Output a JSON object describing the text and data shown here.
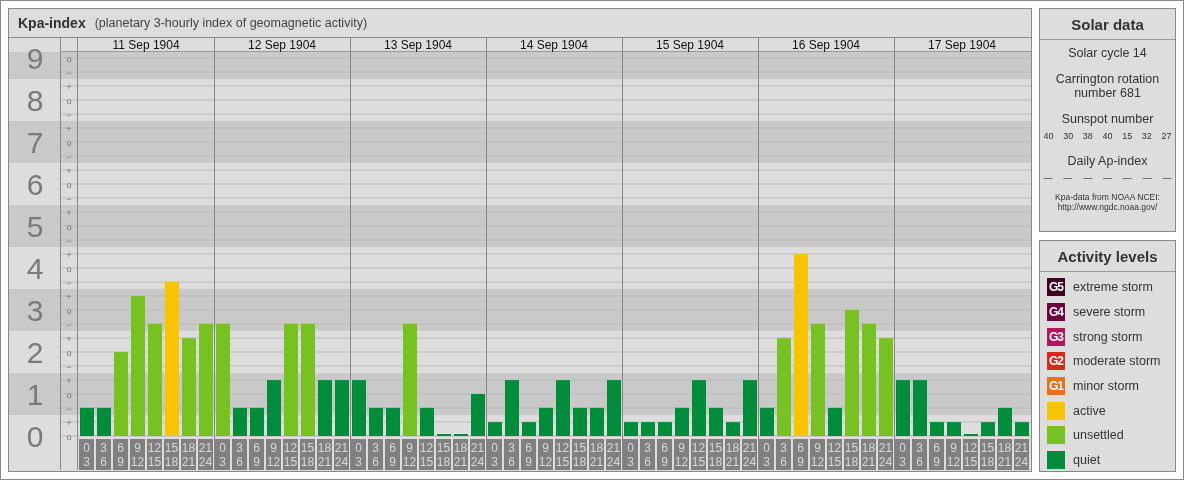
{
  "kpa_panel": {
    "title": "Kpa-index",
    "subtitle": "(planetary 3-hourly index of geomagnetic activity)",
    "days": [
      "11 Sep 1904",
      "12 Sep 1904",
      "13 Sep 1904",
      "14 Sep 1904",
      "15 Sep 1904",
      "16 Sep 1904",
      "17 Sep 1904"
    ],
    "minor_ticks": [
      "o",
      "−",
      "+",
      "o",
      "−",
      "+",
      "o",
      "−",
      "+",
      "o",
      "−",
      "+",
      "o",
      "−",
      "+",
      "o",
      "−",
      "+",
      "o",
      "−",
      "+",
      "o",
      "−",
      "+",
      "o",
      "−",
      "+",
      "o"
    ],
    "chart_data": {
      "type": "bar",
      "stacked": true,
      "categories": [
        "0\n3",
        "3\n6",
        "6\n9",
        "9\n12",
        "12\n15",
        "15\n18",
        "18\n21",
        "21\n24",
        "0\n3",
        "3\n6",
        "6\n9",
        "9\n12",
        "12\n15",
        "15\n18",
        "18\n21",
        "21\n24",
        "0\n3",
        "3\n6",
        "6\n9",
        "9\n12",
        "12\n15",
        "15\n18",
        "18\n21",
        "21\n24",
        "0\n3",
        "3\n6",
        "6\n9",
        "9\n12",
        "12\n15",
        "15\n18",
        "18\n21",
        "21\n24",
        "0\n3",
        "3\n6",
        "6\n9",
        "9\n12",
        "12\n15",
        "15\n18",
        "18\n21",
        "21\n24",
        "0\n3",
        "3\n6",
        "6\n9",
        "9\n12",
        "12\n15",
        "15\n18",
        "18\n21",
        "21\n24",
        "0\n3",
        "3\n6",
        "6\n9",
        "9\n12",
        "12\n15",
        "15\n18",
        "18\n21",
        "21\n24"
      ],
      "yticks": [
        {
          "value": 0,
          "label": "0"
        },
        {
          "value": 1,
          "label": "1"
        },
        {
          "value": 2,
          "label": "2"
        },
        {
          "value": 3,
          "label": "3"
        },
        {
          "value": 4,
          "label": "4"
        },
        {
          "value": 5,
          "label": "5"
        },
        {
          "value": 6,
          "label": "6"
        },
        {
          "value": 7,
          "label": "7"
        },
        {
          "value": 8,
          "label": "8"
        },
        {
          "value": 9,
          "label": "9"
        }
      ],
      "ylim": [
        0,
        9.14
      ],
      "grid": true,
      "series": [
        {
          "name": "active",
          "color": "#f8c300",
          "values": [
            null,
            null,
            null,
            null,
            null,
            3.67,
            null,
            null,
            null,
            null,
            null,
            null,
            null,
            null,
            null,
            null,
            null,
            null,
            null,
            null,
            null,
            null,
            null,
            null,
            null,
            null,
            null,
            null,
            null,
            null,
            null,
            null,
            null,
            null,
            null,
            null,
            null,
            null,
            null,
            null,
            null,
            null,
            4.33,
            null,
            null,
            null,
            null,
            null,
            null,
            null,
            null,
            null,
            null,
            null,
            null,
            null
          ]
        },
        {
          "name": "unsettled",
          "color": "#77c122",
          "values": [
            null,
            null,
            2,
            3.33,
            2.67,
            null,
            2.33,
            2.67,
            2.67,
            null,
            null,
            null,
            2.67,
            2.67,
            null,
            null,
            null,
            null,
            null,
            2.67,
            null,
            null,
            null,
            null,
            null,
            null,
            null,
            null,
            null,
            null,
            null,
            null,
            null,
            null,
            null,
            null,
            null,
            null,
            null,
            null,
            null,
            2.33,
            null,
            2.67,
            null,
            3,
            2.67,
            2.33,
            null,
            null,
            null,
            null,
            null,
            null,
            null,
            null
          ]
        },
        {
          "name": "quiet",
          "color": "#008c3a",
          "values": [
            0.67,
            0.67,
            null,
            null,
            null,
            null,
            null,
            null,
            null,
            0.67,
            0.67,
            1.33,
            null,
            null,
            1.33,
            1.33,
            1.33,
            0.67,
            0.67,
            null,
            0.67,
            0,
            0,
            1,
            0.33,
            1.33,
            0.33,
            0.67,
            1.33,
            0.67,
            0.67,
            1.33,
            0.33,
            0.33,
            0.33,
            0.67,
            1.33,
            0.67,
            0.33,
            1.33,
            0.67,
            null,
            null,
            null,
            0.67,
            null,
            null,
            null,
            1.33,
            1.33,
            0.33,
            0.33,
            0,
            0.33,
            0.67,
            0.33
          ]
        }
      ]
    }
  },
  "solar_panel": {
    "title": "Solar data",
    "solar_cycle": "Solar cycle 14",
    "carrington": "Carrington rotation number 681",
    "sunspot_title": "Sunspot number",
    "sunspots": [
      "40",
      "30",
      "38",
      "40",
      "15",
      "32",
      "27"
    ],
    "ap_title": "Daily Ap-index",
    "ap_values": [
      "—",
      "—",
      "—",
      "—",
      "—",
      "—",
      "—"
    ],
    "source_note": "Kpa-data from NOAA NCEI:",
    "source_url": "http://www.ngdc.noaa.gov/"
  },
  "activity_panel": {
    "title": "Activity levels",
    "items": [
      {
        "badge": "G5",
        "label": "extreme storm",
        "color": "#3f0024"
      },
      {
        "badge": "G4",
        "label": "severe storm",
        "color": "#6b0040"
      },
      {
        "badge": "G3",
        "label": "strong storm",
        "color": "#b2145e"
      },
      {
        "badge": "G2",
        "label": "moderate storm",
        "color": "#d8281c"
      },
      {
        "badge": "G1",
        "label": "minor storm",
        "color": "#e3711e"
      }
    ]
  }
}
